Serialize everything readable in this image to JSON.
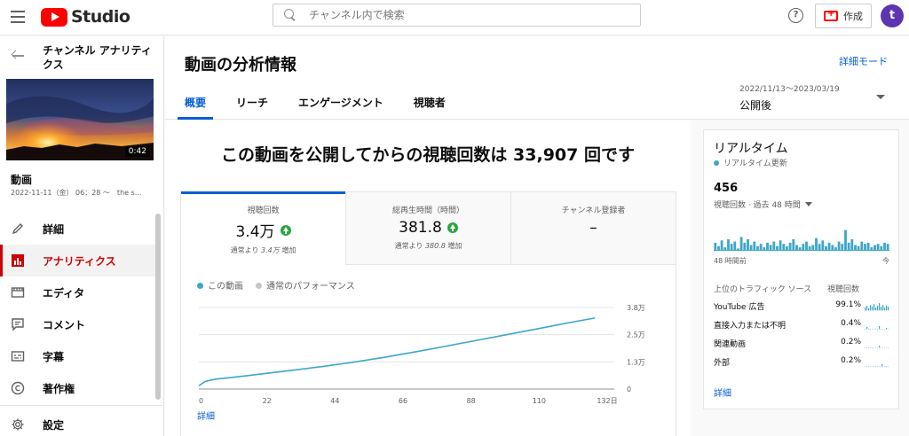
{
  "topbar": {
    "logo_text": "Studio",
    "search_placeholder": "チャンネル内で検索",
    "help_label": "?",
    "create_label": "作成",
    "avatar_letter": "t",
    "brand_color": "#ff0000"
  },
  "sidebar": {
    "title": "チャンネル アナリティクス",
    "thumbnail_duration": "0:42",
    "video_label": "動画",
    "video_date": "2022-11-11（金） 06：28 ～　the s...",
    "items": [
      {
        "label": "詳細",
        "icon": "pencil-icon",
        "active": false
      },
      {
        "label": "アナリティクス",
        "icon": "analytics-icon",
        "active": true
      },
      {
        "label": "エディタ",
        "icon": "editor-icon",
        "active": false
      },
      {
        "label": "コメント",
        "icon": "comment-icon",
        "active": false
      },
      {
        "label": "字幕",
        "icon": "subtitles-icon",
        "active": false
      },
      {
        "label": "著作権",
        "icon": "copyright-icon",
        "active": false
      }
    ],
    "settings_label": "設定"
  },
  "header": {
    "page_title": "動画の分析情報",
    "detail_mode": "詳細モード",
    "tabs": [
      {
        "label": "概要",
        "active": true
      },
      {
        "label": "リーチ",
        "active": false
      },
      {
        "label": "エンゲージメント",
        "active": false
      },
      {
        "label": "視聴者",
        "active": false
      }
    ],
    "date_range": "2022/11/13～2023/03/19",
    "date_value": "公開後"
  },
  "overview": {
    "headline": "この動画を公開してからの視聴回数は 33,907 回です",
    "metrics": [
      {
        "label": "視聴回数",
        "value": "3.4万",
        "sub": "通常より 3.4万 増加",
        "sub_prefix": "通常より ",
        "sub_value": "3.4万",
        "sub_suffix": " 増加",
        "selected": true
      },
      {
        "label": "総再生時間（時間）",
        "value": "381.8",
        "sub_prefix": "通常より ",
        "sub_value": "380.8",
        "sub_suffix": " 増加",
        "selected": false
      },
      {
        "label": "チャンネル登録者",
        "value": "–",
        "selected": false
      }
    ],
    "legend": {
      "this_video": "この動画",
      "typical": "通常のパフォーマンス"
    },
    "more_link": "詳細"
  },
  "chart_data": {
    "type": "line",
    "x_ticks": [
      "0",
      "22",
      "44",
      "66",
      "88",
      "110",
      "132日"
    ],
    "y_ticks": [
      "0",
      "1.3万",
      "2.5万",
      "3.8万"
    ],
    "xlim": [
      0,
      132
    ],
    "ylim": [
      0,
      38000
    ],
    "series": [
      {
        "name": "この動画",
        "color": "#3ea6c8",
        "x": [
          0,
          2,
          4,
          6,
          8,
          10,
          15,
          20,
          30,
          40,
          50,
          60,
          70,
          80,
          90,
          100,
          110,
          120,
          128
        ],
        "y": [
          1500,
          3500,
          4200,
          4700,
          5000,
          5300,
          6100,
          7000,
          8700,
          10500,
          12500,
          14800,
          17300,
          20000,
          22700,
          25500,
          28200,
          31000,
          33100
        ]
      }
    ],
    "legend_entries": [
      "この動画",
      "通常のパフォーマンス"
    ],
    "legend_colors": [
      "#3ea6c8",
      "#c6c6c6"
    ],
    "grid": true
  },
  "realtime": {
    "title": "リアルタイム",
    "update_label": "リアルタイム更新",
    "count": "456",
    "sub_label": "視聴回数 · 過去 48 時間",
    "axis_left": "48 時間前",
    "axis_right": "今",
    "table_header_left": "上位のトラフィック ソース",
    "table_header_right": "視聴回数",
    "rows": [
      {
        "name": "YouTube 広告",
        "pct": "99.1%"
      },
      {
        "name": "直接入力または不明",
        "pct": "0.4%"
      },
      {
        "name": "関連動画",
        "pct": "0.2%"
      },
      {
        "name": "外部",
        "pct": "0.2%"
      }
    ],
    "more_link": "詳細",
    "bars": [
      0.35,
      0.2,
      0.45,
      0.15,
      0.5,
      0.3,
      0.4,
      0.1,
      0.6,
      0.35,
      0.5,
      0.25,
      0.4,
      0.2,
      0.3,
      0.15,
      0.35,
      0.25,
      0.4,
      0.2,
      0.45,
      0.3,
      0.2,
      0.35,
      0.5,
      0.25,
      0.15,
      0.3,
      0.4,
      0.2,
      0.25,
      0.55,
      0.3,
      0.45,
      0.2,
      0.35,
      0.25,
      0.15,
      0.4,
      0.3,
      0.9,
      0.35,
      0.5,
      0.25,
      0.2,
      0.4,
      0.3,
      0.35,
      0.15,
      0.25,
      0.3,
      0.2,
      0.35,
      0.3
    ]
  }
}
